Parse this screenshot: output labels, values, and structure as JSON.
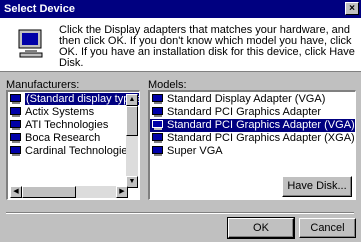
{
  "window": {
    "title": "Select Device",
    "close_glyph": "×"
  },
  "description": "Click the Display adapters that matches your hardware, and then click OK. If you don't know which model you have, click OK. If you have an installation disk for this device, click Have Disk.",
  "manufacturers": {
    "label": "Manufacturers:",
    "items": [
      "(Standard display types)",
      "Actix Systems",
      "ATI Technologies",
      "Boca Research",
      "Cardinal Technologies"
    ],
    "selected": "(Standard display types)"
  },
  "models": {
    "label": "Models:",
    "items": [
      "Standard Display Adapter (VGA)",
      "Standard PCI Graphics Adapter",
      "Standard PCI Graphics Adapter (VGA)",
      "Standard PCI Graphics Adapter (XGA)",
      "Super VGA"
    ],
    "selected": "Standard PCI Graphics Adapter (VGA)"
  },
  "buttons": {
    "have_disk": "Have Disk...",
    "ok": "OK",
    "cancel": "Cancel"
  },
  "icons": {
    "monitor": "monitor-icon",
    "display": "display-adapter-icon"
  },
  "colors": {
    "selection": "#000080",
    "face": "#c0c0c0",
    "title": "#000080"
  }
}
